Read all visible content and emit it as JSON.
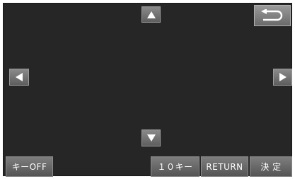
{
  "arrows": {
    "up_icon": "triangle-up",
    "down_icon": "triangle-down",
    "left_icon": "triangle-left",
    "right_icon": "triangle-right"
  },
  "back": {
    "icon": "return-arrow"
  },
  "bottom_bar": {
    "key_off_label": "キーOFF",
    "ten_key_label": "１０キー",
    "return_label": "RETURN",
    "confirm_label": "決 定"
  },
  "colors": {
    "screen_background": "#262626",
    "button_face": "#6e6e6e",
    "text": "#ffffff"
  }
}
